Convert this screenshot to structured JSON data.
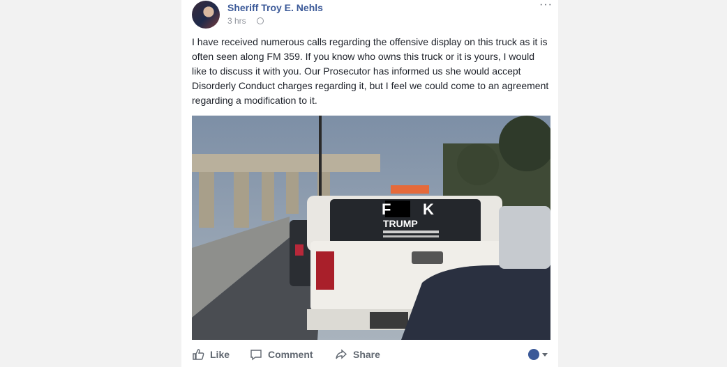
{
  "post": {
    "author": "Sheriff Troy E. Nehls",
    "timestamp": "3 hrs",
    "text": "I have received numerous calls regarding the offensive display on this truck as it is often seen along FM 359. If you know who owns this truck or it is yours, I would like to discuss it with you. Our Prosecutor has informed us she would accept Disorderly Conduct charges regarding it, but I feel we could come to an agreement regarding a modification to it."
  },
  "photo": {
    "window_line1_left": "F",
    "window_line1_right": "K",
    "window_line2": "TRUMP"
  },
  "actions": {
    "like": "Like",
    "comment": "Comment",
    "share": "Share"
  },
  "icons": [
    "globe-icon",
    "more-options-icon",
    "like-icon",
    "comment-icon",
    "share-icon",
    "reaction-selector-icon"
  ],
  "colors": {
    "author_link": "#3b5998",
    "action_text": "#606770",
    "meta_text": "#90949c"
  }
}
